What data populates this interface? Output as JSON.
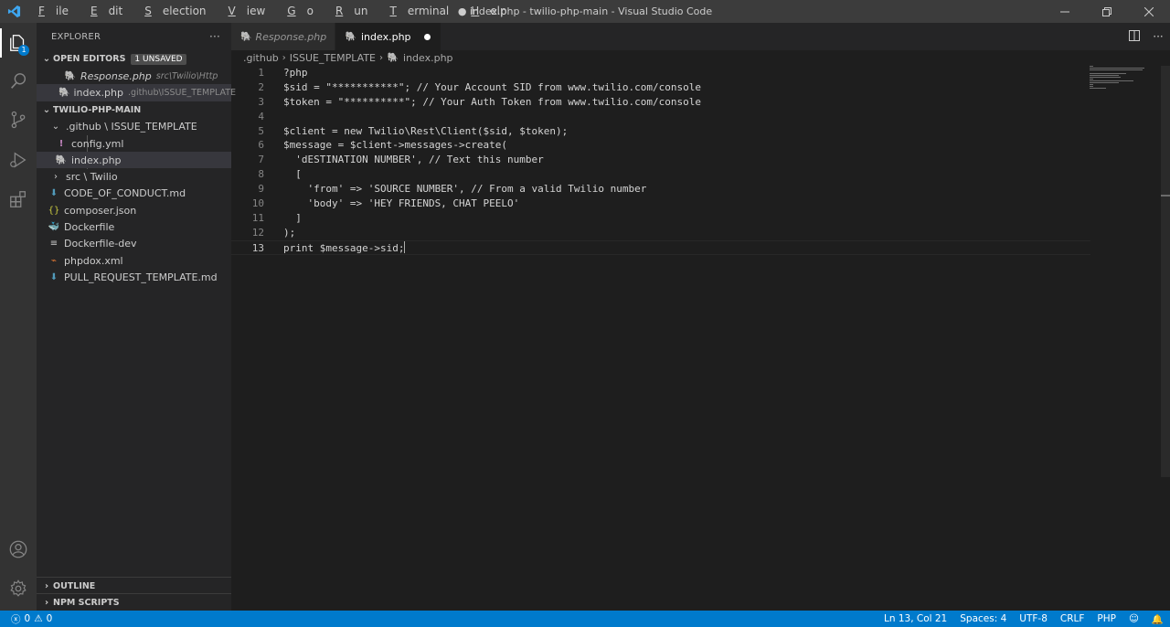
{
  "window": {
    "title": "● index.php - twilio-php-main - Visual Studio Code",
    "menu": [
      {
        "pre": "",
        "u": "F",
        "post": "ile"
      },
      {
        "pre": "",
        "u": "E",
        "post": "dit"
      },
      {
        "pre": "",
        "u": "S",
        "post": "election"
      },
      {
        "pre": "",
        "u": "V",
        "post": "iew"
      },
      {
        "pre": "",
        "u": "G",
        "post": "o"
      },
      {
        "pre": "",
        "u": "R",
        "post": "un"
      },
      {
        "pre": "",
        "u": "T",
        "post": "erminal"
      },
      {
        "pre": "",
        "u": "H",
        "post": "elp"
      }
    ]
  },
  "activity": {
    "badge": "1"
  },
  "sidebar": {
    "title": "EXPLORER",
    "more": "···",
    "open_editors": {
      "label": "OPEN EDITORS",
      "pill": "1 UNSAVED",
      "items": [
        {
          "name": "Response.php",
          "path": "src\\Twilio\\Http"
        },
        {
          "name": "index.php",
          "path": ".github\\ISSUE_TEMPLATE"
        }
      ]
    },
    "project": {
      "label": "TWILIO-PHP-MAIN",
      "folder": ".github \\ ISSUE_TEMPLATE",
      "files": [
        {
          "name": "config.yml",
          "icon": "!",
          "color": "#c586c0"
        },
        {
          "name": "index.php",
          "icon": "php",
          "color": "#a074c4"
        }
      ],
      "src": "src \\ Twilio",
      "root_files": [
        {
          "name": "CODE_OF_CONDUCT.md",
          "icon": "md",
          "color": "#519aba"
        },
        {
          "name": "composer.json",
          "icon": "{}",
          "color": "#cbcb41"
        },
        {
          "name": "Dockerfile",
          "icon": "docker",
          "color": "#519aba"
        },
        {
          "name": "Dockerfile-dev",
          "icon": "lines",
          "color": "#cccccc"
        },
        {
          "name": "phpdox.xml",
          "icon": "rss",
          "color": "#e37933"
        },
        {
          "name": "PULL_REQUEST_TEMPLATE.md",
          "icon": "md",
          "color": "#519aba"
        }
      ]
    },
    "outline": "OUTLINE",
    "npm": "NPM SCRIPTS"
  },
  "tabs": [
    {
      "label": "Response.php"
    },
    {
      "label": "index.php"
    }
  ],
  "breadcrumb": {
    "a": ".github",
    "b": "ISSUE_TEMPLATE",
    "c": "index.php"
  },
  "code": [
    "?php",
    "$sid = \"***********\"; // Your Account SID from www.twilio.com/console",
    "$token = \"**********\"; // Your Auth Token from www.twilio.com/console",
    "",
    "$client = new Twilio\\Rest\\Client($sid, $token);",
    "$message = $client->messages->create(",
    "  'dESTINATION NUMBER', // Text this number",
    "  [",
    "    'from' => 'SOURCE NUMBER', // From a valid Twilio number",
    "    'body' => 'HEY FRIENDS, CHAT PEELO'",
    "  ]",
    ");",
    "print $message->sid;"
  ],
  "status": {
    "errors": "0",
    "warnings": "0",
    "position": "Ln 13, Col 21",
    "spaces": "Spaces: 4",
    "encoding": "UTF-8",
    "eol": "CRLF",
    "language": "PHP"
  }
}
